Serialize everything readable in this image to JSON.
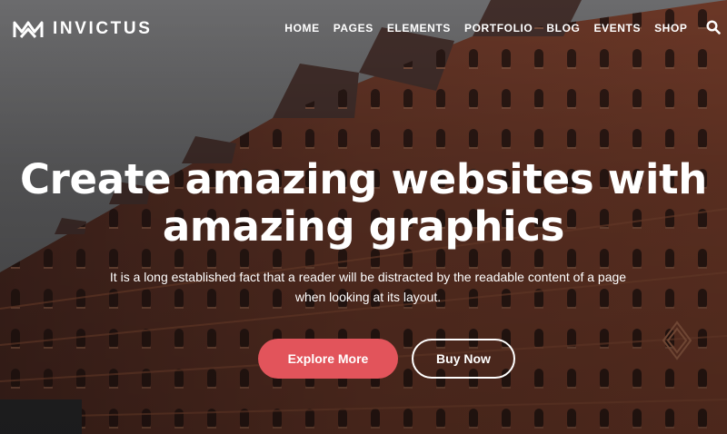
{
  "brand": {
    "name": "INVICTUS"
  },
  "nav": {
    "items": [
      "HOME",
      "PAGES",
      "ELEMENTS",
      "PORTFOLIO",
      "BLOG",
      "EVENTS",
      "SHOP"
    ],
    "search_icon": "search-icon"
  },
  "hero": {
    "title_line1": "Create amazing websites with",
    "title_line2": "amazing graphics",
    "subtitle": "It is a long established fact that a reader will be distracted by the readable content of a page when looking at its layout.",
    "primary_button": "Explore More",
    "secondary_button": "Buy Now"
  },
  "colors": {
    "accent": "#e2545b",
    "text": "#ffffff",
    "brick": "#6b3a2a"
  }
}
